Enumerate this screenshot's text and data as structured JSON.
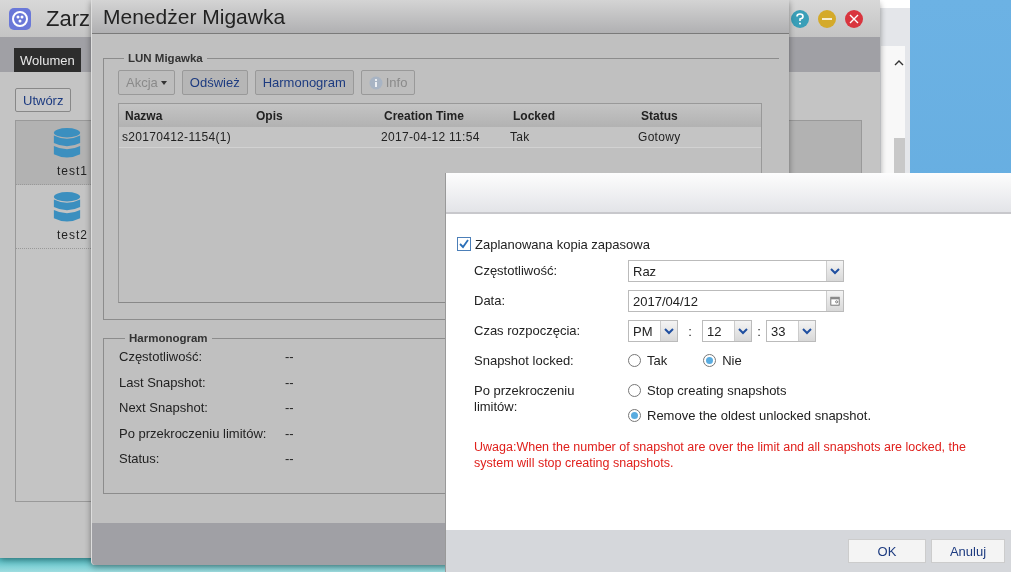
{
  "back_window": {
    "title": "Zarz",
    "tabs": [
      {
        "label": "Wolumen",
        "selected": true
      }
    ],
    "toolbar": [
      "Utwórz"
    ],
    "volumes": [
      {
        "name": "test1",
        "selected": true
      },
      {
        "name": "test2",
        "selected": false
      }
    ]
  },
  "snapshot_window": {
    "title": "Menedżer Migawka",
    "lun_section": {
      "legend": "LUN Migawka",
      "buttons": [
        {
          "label": "Akcja",
          "kind": "dropdown",
          "disabled": true
        },
        {
          "label": "Odśwież",
          "kind": "plain",
          "disabled": false
        },
        {
          "label": "Harmonogram",
          "kind": "plain",
          "disabled": false
        },
        {
          "label": "Info",
          "kind": "info",
          "disabled": true
        }
      ],
      "table": {
        "columns": [
          "Nazwa",
          "Opis",
          "Creation Time",
          "Locked",
          "Status"
        ],
        "rows": [
          [
            "s20170412-1154(1)",
            "",
            "2017-04-12 11:54",
            "Tak",
            "Gotowy"
          ]
        ]
      }
    },
    "schedule_section": {
      "legend": "Harmonogram",
      "fields": [
        {
          "label": "Częstotliwość:",
          "value": "--"
        },
        {
          "label": "Last Snapshot:",
          "value": "--"
        },
        {
          "label": "Next Snapshot:",
          "value": "--"
        },
        {
          "label": "Po przekroczeniu limitów:",
          "value": "--"
        },
        {
          "label": "Status:",
          "value": "--"
        }
      ]
    }
  },
  "dialog": {
    "enable": {
      "label": "Zaplanowana kopia zapasowa",
      "checked": true
    },
    "rows": [
      {
        "kind": "select",
        "label": "Częstotliwość:",
        "value": "Raz"
      },
      {
        "kind": "date",
        "label": "Data:",
        "value": "2017/04/12"
      },
      {
        "kind": "time",
        "label": "Czas rozpoczęcia:",
        "parts": [
          {
            "kind": "select",
            "value": "PM"
          },
          {
            "kind": "separator",
            "text": ":"
          },
          {
            "kind": "select",
            "value": "12"
          },
          {
            "kind": "separator",
            "text": ":"
          },
          {
            "kind": "select",
            "value": "33"
          }
        ]
      },
      {
        "kind": "radio_row",
        "label": "Snapshot locked:",
        "options": [
          {
            "label": "Tak",
            "selected": false
          },
          {
            "label": "Nie",
            "selected": true
          }
        ]
      },
      {
        "kind": "radio_column",
        "label": "Po przekroczeniu limitów:",
        "options": [
          {
            "label": "Stop creating snapshots",
            "selected": false
          },
          {
            "label": "Remove the oldest unlocked snapshot.",
            "selected": true
          }
        ]
      }
    ],
    "warning": "Uwaga:When the number of snapshot are over the limit and all snapshots are locked, the system will stop creating snapshots.",
    "buttons": [
      "OK",
      "Anuluj"
    ]
  }
}
